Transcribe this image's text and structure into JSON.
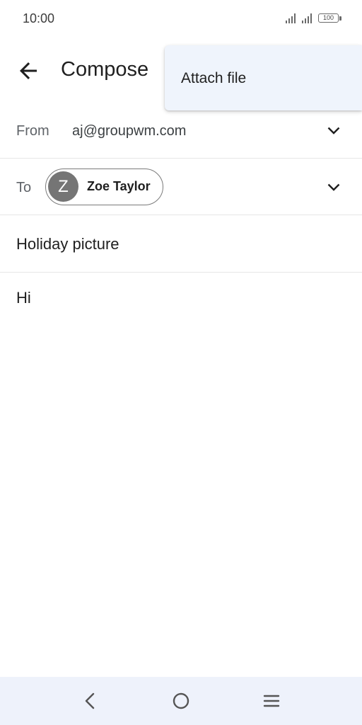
{
  "status_bar": {
    "time": "10:00",
    "battery": "100"
  },
  "app_bar": {
    "title": "Compose"
  },
  "menu": {
    "items": [
      {
        "label": "Attach file"
      }
    ]
  },
  "compose": {
    "from_label": "From",
    "from_value": "aj@groupwm.com",
    "to_label": "To",
    "recipient": {
      "initial": "Z",
      "name": "Zoe Taylor"
    },
    "subject": "Holiday picture",
    "body": "Hi"
  },
  "icons": {
    "back": "arrow-back-icon",
    "expand": "chevron-down-icon",
    "nav_back": "nav-back-icon",
    "nav_home": "nav-home-icon",
    "nav_recents": "nav-menu-icon"
  }
}
